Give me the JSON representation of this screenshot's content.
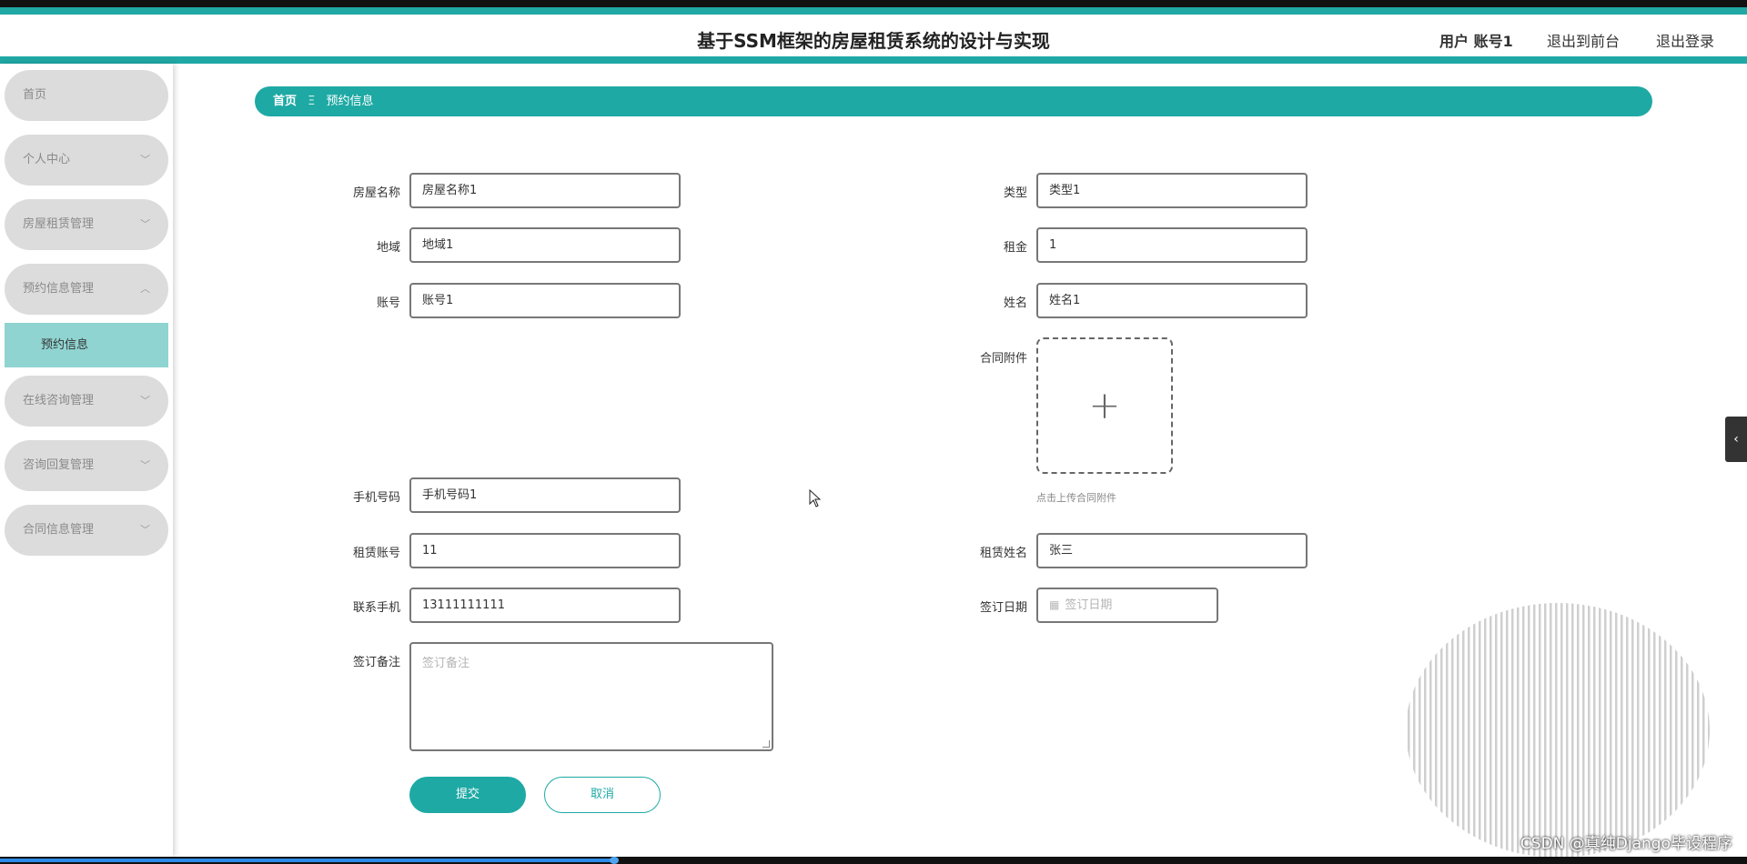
{
  "header": {
    "title": "基于SSM框架的房屋租赁系统的设计与实现",
    "user_label": "用户 账号1",
    "front_label": "退出到前台",
    "logout_label": "退出登录"
  },
  "sidebar": {
    "items": [
      {
        "label": "首页"
      },
      {
        "label": "个人中心"
      },
      {
        "label": "房屋租赁管理"
      },
      {
        "label": "预约信息管理"
      },
      {
        "label": "在线咨询管理"
      },
      {
        "label": "咨询回复管理"
      },
      {
        "label": "合同信息管理"
      }
    ],
    "sub_item": "预约信息"
  },
  "breadcrumb": {
    "home": "首页",
    "separator": "Ξ",
    "current": "预约信息"
  },
  "form": {
    "house_name": {
      "label": "房屋名称",
      "value": "房屋名称1"
    },
    "type": {
      "label": "类型",
      "value": "类型1"
    },
    "region": {
      "label": "地域",
      "value": "地域1"
    },
    "rent": {
      "label": "租金",
      "value": "1"
    },
    "account": {
      "label": "账号",
      "value": "账号1"
    },
    "name": {
      "label": "姓名",
      "value": "姓名1"
    },
    "contract_file": {
      "label": "合同附件",
      "hint": "点击上传合同附件"
    },
    "phone": {
      "label": "手机号码",
      "value": "手机号码1"
    },
    "renter_account": {
      "label": "租赁账号",
      "value": "11"
    },
    "renter_name": {
      "label": "租赁姓名",
      "value": "张三"
    },
    "contact_phone": {
      "label": "联系手机",
      "value": "13111111111"
    },
    "sign_date": {
      "label": "签订日期",
      "placeholder": "签订日期"
    },
    "sign_remark": {
      "label": "签订备注",
      "placeholder": "签订备注"
    }
  },
  "buttons": {
    "submit": "提交",
    "cancel": "取消"
  },
  "watermark": "CSDN @真纯Django毕设程序",
  "colors": {
    "accent": "#1ea9a4",
    "submenu_active": "#8fd4d1",
    "menu_bg": "#dcdcdc"
  }
}
